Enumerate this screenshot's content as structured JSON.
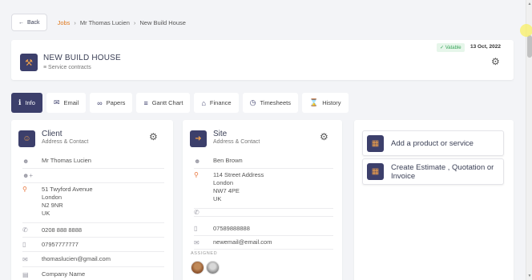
{
  "breadcrumb": {
    "back_label": "Back",
    "items": [
      "Jobs",
      "Mr Thomas Lucien",
      "New Build House"
    ]
  },
  "job": {
    "title": "NEW BUILD HOUSE",
    "subtitle": "Service contracts",
    "badge": "Vatable",
    "date": "13 Oct, 2022"
  },
  "tabs": [
    {
      "label": "Info",
      "icon": "info-icon",
      "active": true
    },
    {
      "label": "Email",
      "icon": "envelope-icon",
      "active": false
    },
    {
      "label": "Papers",
      "icon": "paperclip-icon",
      "active": false
    },
    {
      "label": "Gantt Chart",
      "icon": "gantt-icon",
      "active": false
    },
    {
      "label": "Finance",
      "icon": "bank-icon",
      "active": false
    },
    {
      "label": "Timesheets",
      "icon": "stopwatch-icon",
      "active": false
    },
    {
      "label": "History",
      "icon": "hourglass-icon",
      "active": false
    }
  ],
  "client": {
    "title": "Client",
    "subtitle": "Address & Contact",
    "name": "Mr Thomas Lucien",
    "contact": "",
    "address": [
      "51 Twyford Avenue",
      "London",
      "N2 9NR",
      "UK"
    ],
    "phone": "0208 888 8888",
    "mobile": "07957777777",
    "email": "thomaslucien@gmail.com",
    "company": "Company Name"
  },
  "site": {
    "title": "Site",
    "subtitle": "Address & Contact",
    "contact": "Ben Brown",
    "address": [
      "114 Street Address",
      "London",
      "NW7 4PE",
      "UK"
    ],
    "phone": "",
    "mobile": "07589888888",
    "email": "newemail@email.com",
    "assigned_label": "ASSIGNED"
  },
  "actions": [
    {
      "label": "Add a product or service",
      "icon": "brick-icon"
    },
    {
      "label": "Create Estimate , Quotation or Invoice",
      "icon": "calculator-icon"
    }
  ],
  "colors": {
    "accent": "#3c3f6b",
    "brand_orange": "#e07a1f",
    "vatable_green": "#3aa55a"
  }
}
